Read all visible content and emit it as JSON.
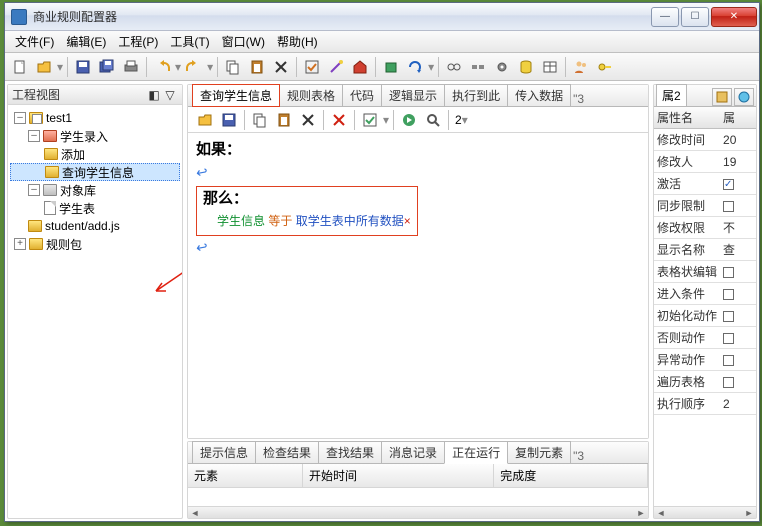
{
  "window": {
    "title": "商业规则配置器"
  },
  "menu": {
    "file": "文件(F)",
    "edit": "编辑(E)",
    "project": "工程(P)",
    "tools": "工具(T)",
    "window": "窗口(W)",
    "help": "帮助(H)"
  },
  "left_panel": {
    "title": "工程视图",
    "collapse": "▽"
  },
  "tree": {
    "root": "test1",
    "n1": "学生录入",
    "n1a": "添加",
    "n1b": "查询学生信息",
    "n2": "对象库",
    "n2a": "学生表",
    "n3": "student/add.js",
    "n4": "规则包"
  },
  "tabs": {
    "t1": "查询学生信息",
    "t2": "规则表格",
    "t3": "代码",
    "t4": "逻辑显示",
    "t5": "执行到此",
    "t6": "传入数据",
    "more": "\"3"
  },
  "editor": {
    "if": "如果：",
    "else": "那么：",
    "seg_green": "学生信息",
    "seg_orange": "等于",
    "seg_blue": "取学生表中所有数据",
    "x": "×"
  },
  "bottom_tabs": {
    "b1": "提示信息",
    "b2": "检查结果",
    "b3": "查找结果",
    "b4": "消息记录",
    "b5": "正在运行",
    "b6": "复制元素",
    "more": "\"3"
  },
  "bottom_cols": {
    "c1": "元素",
    "c2": "开始时间",
    "c3": "完成度"
  },
  "right_tabs": {
    "r1": "属2"
  },
  "props": {
    "hname": "属性名",
    "hval": "属",
    "r1n": "修改时间",
    "r1v": "20",
    "r2n": "修改人",
    "r2v": "19",
    "r3n": "激活",
    "r4n": "同步限制",
    "r5n": "修改权限",
    "r5v": "不",
    "r6n": "显示名称",
    "r6v": "查",
    "r7n": "表格状编辑",
    "r8n": "进入条件",
    "r9n": "初始化动作",
    "r10n": "否则动作",
    "r11n": "异常动作",
    "r12n": "遍历表格",
    "r13n": "执行顺序",
    "r13v": "2"
  },
  "etb": {
    "dd": "2"
  }
}
